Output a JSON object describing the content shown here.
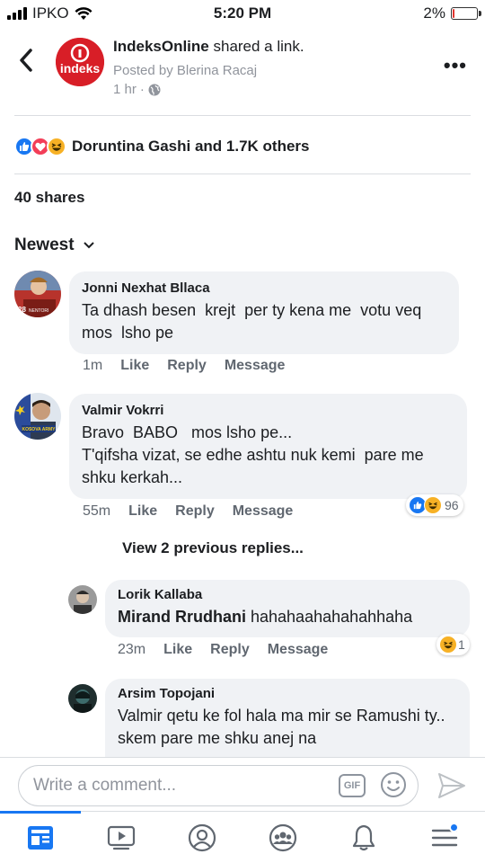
{
  "status_bar": {
    "carrier": "IPKO",
    "time": "5:20 PM",
    "battery_percent": "2%",
    "battery_level": 0.02
  },
  "post": {
    "page_name": "IndeksOnline",
    "action_text": "shared a link.",
    "posted_by": "Posted by Blerina Racaj",
    "time": "1 hr",
    "page_logo_text": "indeks",
    "reactions_label": "Doruntina Gashi and 1.7K others",
    "reaction_icons": [
      "like-icon",
      "love-icon",
      "haha-icon"
    ],
    "shares": "40 shares",
    "sort_label": "Newest"
  },
  "comments": [
    {
      "name": "Jonni Nexhat Bllaca",
      "text": "Ta dhash besen  krejt  per ty kena me  votu veq  mos  lsho pe",
      "avatar_badge": "28",
      "avatar_badge_text": "NENTORI",
      "time": "1m",
      "like": "Like",
      "reply": "Reply",
      "message": "Message"
    },
    {
      "name": "Valmir Vokrri",
      "text": "Bravo  BABO   mos lsho pe...\nT'qifsha vizat, se edhe ashtu nuk kemi  pare me shku kerkah...",
      "avatar_badge_text": "KOSOVA ARMY",
      "time": "55m",
      "like": "Like",
      "reply": "Reply",
      "message": "Message",
      "reaction_count": "96"
    }
  ],
  "view_previous": "View 2 previous replies...",
  "replies": [
    {
      "name": "Lorik Kallaba",
      "mention": "Mirand Rrudhani",
      "text": " hahahaahahahahhaha",
      "time": "23m",
      "like": "Like",
      "reply": "Reply",
      "message": "Message",
      "reaction_count": "1"
    },
    {
      "name": "Arsim Topojani",
      "text": "Valmir qetu ke fol hala ma mir se Ramushi ty.. skem pare me shku anej na"
    }
  ],
  "composer": {
    "placeholder": "Write a comment...",
    "gif_label": "GIF"
  },
  "tabs": [
    "news-feed-icon",
    "watch-icon",
    "profile-icon",
    "groups-icon",
    "notifications-icon",
    "menu-icon"
  ],
  "colors": {
    "accent": "#1877f2",
    "like_blue": "#1877f2",
    "love_red": "#f33e58",
    "haha_yellow": "#f7b125",
    "brand_red": "#d81e27"
  }
}
